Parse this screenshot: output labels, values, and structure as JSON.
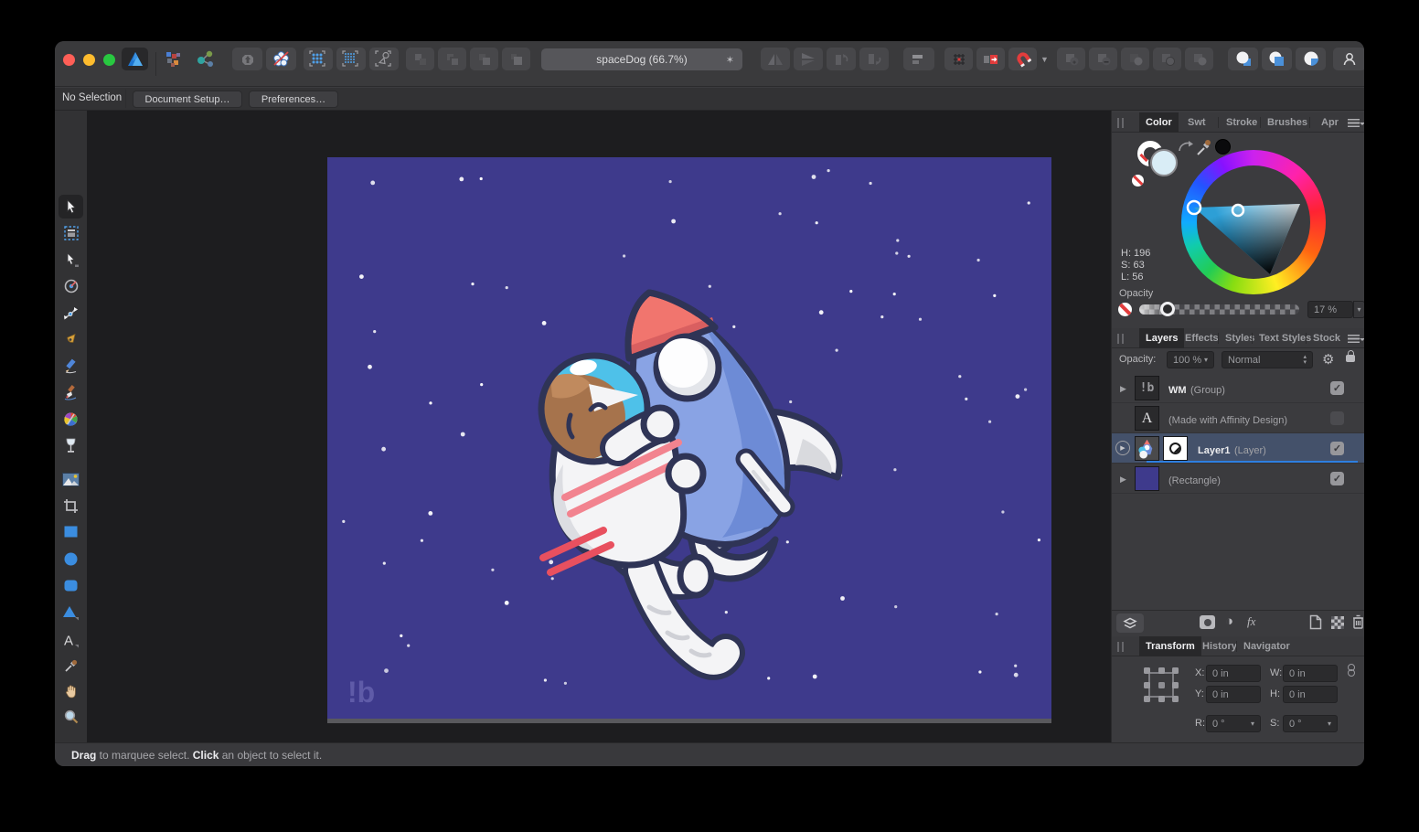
{
  "window": {
    "title": "spaceDog (66.7%)",
    "title_star": "✶"
  },
  "context_bar": {
    "selection_status": "No Selection",
    "document_setup": "Document Setup…",
    "preferences": "Preferences…"
  },
  "color_panel": {
    "tabs": [
      "Color",
      "Swt",
      "Stroke",
      "Brushes",
      "Apr"
    ],
    "hue": "H: 196",
    "saturation": "S: 63",
    "luminosity": "L: 56",
    "opacity_label": "Opacity",
    "opacity_value": "17 %",
    "fill_color": "#d9edf6",
    "hue_angle": 196
  },
  "layers_panel": {
    "tabs": [
      "Layers",
      "Effects",
      "Styles",
      "Text Styles",
      "Stock"
    ],
    "opacity_label": "Opacity:",
    "opacity_value": "100 %",
    "blend_mode": "Normal",
    "fx_label": "fx",
    "layers": [
      {
        "title": "WM",
        "subtitle": "(Group)",
        "state": "checked",
        "thumb_glyph": "!b"
      },
      {
        "title": "",
        "subtitle": "(Made with Affinity Design)",
        "state": "unchecked",
        "thumb_glyph": "A"
      },
      {
        "title": "Layer1",
        "subtitle": "(Layer)",
        "state": "checked"
      },
      {
        "title": "",
        "subtitle": "(Rectangle)",
        "state": "checked"
      }
    ]
  },
  "transform_panel": {
    "tabs": [
      "Transform",
      "History",
      "Navigator"
    ],
    "x_label": "X:",
    "x_value": "0 in",
    "y_label": "Y:",
    "y_value": "0 in",
    "w_label": "W:",
    "w_value": "0 in",
    "h_label": "H:",
    "h_value": "0 in",
    "r_label": "R:",
    "r_value": "0 °",
    "s_label": "S:",
    "s_value": "0 °"
  },
  "status_bar": {
    "drag_word": "Drag",
    "mid_text": " to marquee select. ",
    "click_word": "Click",
    "end_text": " an object to select it."
  },
  "canvas": {
    "watermark": "!b",
    "background": "#3e3a8c"
  }
}
